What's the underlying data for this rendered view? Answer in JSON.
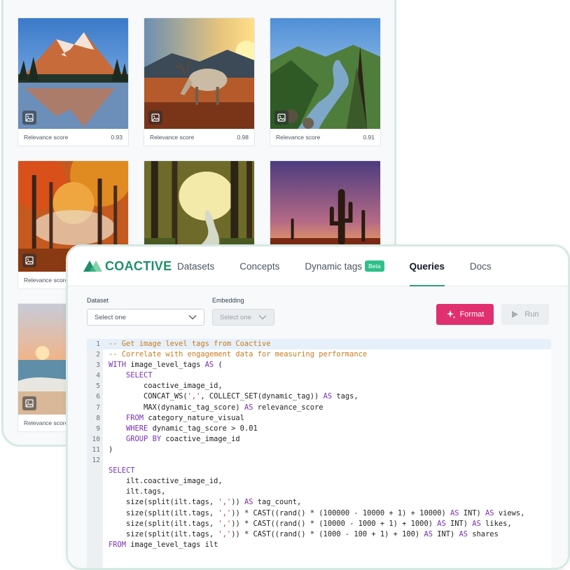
{
  "gallery": {
    "score_label": "Relevance score",
    "cards": [
      {
        "scene": "mountain-lake",
        "score": "0.93"
      },
      {
        "scene": "reindeer",
        "score": "0.98"
      },
      {
        "scene": "river-valley",
        "score": "0.91"
      },
      {
        "scene": "autumn-forest",
        "score": "Relevance score"
      },
      {
        "scene": "forest-stream",
        "score": ""
      },
      {
        "scene": "desert-cactus",
        "score": ""
      },
      {
        "scene": "beach-sunset",
        "score": "Relevance score"
      }
    ]
  },
  "nav": {
    "logo": "COACTIVE",
    "items": [
      "Datasets",
      "Concepts",
      "Dynamic tags",
      "Queries",
      "Docs"
    ],
    "beta_badge": "Beta",
    "active": "Queries"
  },
  "form": {
    "dataset_label": "Dataset",
    "dataset_value": "Select one",
    "embedding_label": "Embedding",
    "embedding_value": "Select one",
    "format_button": "Format",
    "run_button": "Run"
  },
  "colors": {
    "brand": "#1e8f6a",
    "format_button": "#e0306f",
    "comment": "#c97a1c",
    "keyword": "#7b2fb5",
    "string": "#b0403a"
  },
  "code": {
    "line_numbers": [
      "1",
      "2",
      "3",
      "4",
      "5",
      "6",
      "7",
      "8",
      "9",
      "10",
      "11",
      "12"
    ],
    "lines": [
      "-- Get image level tags from Coactive",
      "-- Correlate with engagement data for measuring performance",
      "WITH image_level_tags AS (",
      "    SELECT",
      "        coactive_image_id,",
      "        CONCAT_WS(',', COLLECT_SET(dynamic_tag)) AS tags,",
      "        MAX(dynamic_tag_score) AS relevance_score",
      "    FROM category_nature_visual",
      "    WHERE dynamic_tag_score > 0.01",
      "    GROUP BY coactive_image_id",
      ")",
      "",
      "SELECT",
      "    ilt.coactive_image_id,",
      "    ilt.tags,",
      "    size(split(ilt.tags, ',')) AS tag_count,",
      "    size(split(ilt.tags, ',')) * CAST((rand() * (100000 - 10000 + 1) + 10000) AS INT) AS views,",
      "    size(split(ilt.tags, ',')) * CAST((rand() * (10000 - 1000 + 1) + 1000) AS INT) AS likes,",
      "    size(split(ilt.tags, ',')) * CAST((rand() * (1000 - 100 + 1) + 100) AS INT) AS shares",
      "FROM image_level_tags ilt"
    ]
  }
}
